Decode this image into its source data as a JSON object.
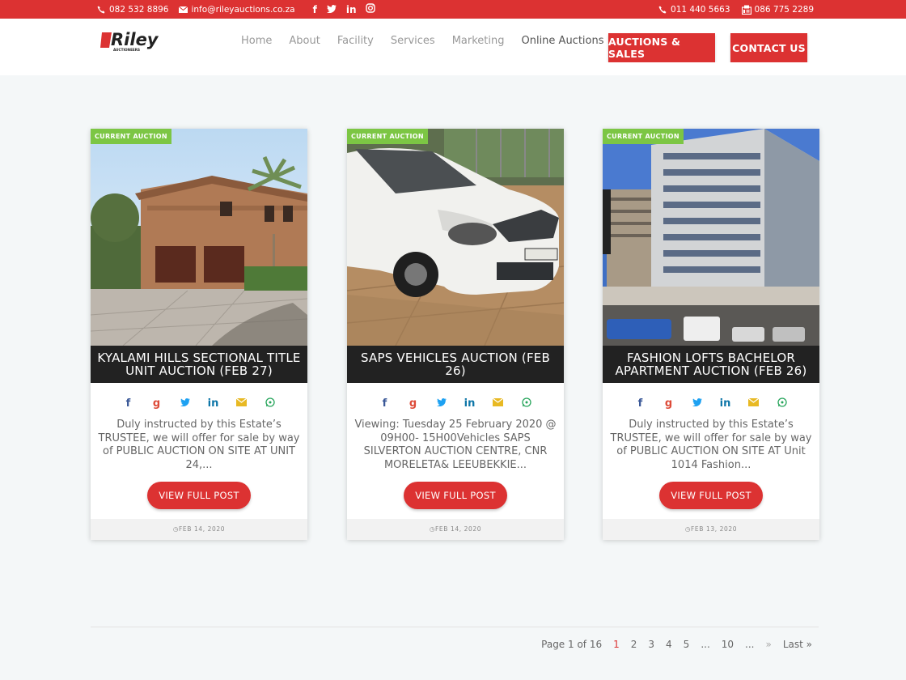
{
  "topbar": {
    "phone1": "082 532 8896",
    "email": "info@rileyauctions.co.za",
    "social": [
      "facebook-icon",
      "twitter-icon",
      "linkedin-icon",
      "instagram-icon"
    ],
    "phone2": "011 440 5663",
    "fax": "086 775 2289",
    "color": "#dc3232"
  },
  "header": {
    "logo_text": "Riley",
    "logo_sub": "AUCTIONEERS",
    "nav": [
      "Home",
      "About",
      "Facility",
      "Services",
      "Marketing",
      "Online Auctions"
    ],
    "cta1": "AUCTIONS & SALES",
    "cta2": "CONTACT US"
  },
  "cards": [
    {
      "badge": "CURRENT AUCTION",
      "title": "KYALAMI HILLS SECTIONAL TITLE UNIT AUCTION (FEB 27)",
      "excerpt": "Duly instructed by this Estate’s TRUSTEE, we will offer for sale by way of PUBLIC AUCTION ON SITE AT UNIT 24,...",
      "button": "VIEW FULL POST",
      "date": "FEB 14, 2020"
    },
    {
      "badge": "CURRENT AUCTION",
      "title": "SAPS VEHICLES AUCTION (FEB 26)",
      "excerpt": "Viewing: Tuesday 25 February 2020 @ 09H00- 15H00Vehicles SAPS SILVERTON AUCTION CENTRE, CNR MORELETA& LEEUBEKKIE...",
      "button": "VIEW FULL POST",
      "date": "FEB 14, 2020"
    },
    {
      "badge": "CURRENT AUCTION",
      "title": "FASHION LOFTS BACHELOR APARTMENT AUCTION (FEB 26)",
      "excerpt": "Duly instructed by this Estate’s TRUSTEE, we will offer for sale by way of PUBLIC AUCTION ON SITE AT Unit 1014 Fashion...",
      "button": "VIEW FULL POST",
      "date": "FEB 13, 2020"
    }
  ],
  "share_icons": [
    "facebook-icon",
    "google-plus-icon",
    "twitter-icon",
    "linkedin-icon",
    "email-icon",
    "whatsapp-icon"
  ],
  "pagination": {
    "label": "Page 1 of 16",
    "pages": [
      "1",
      "2",
      "3",
      "4",
      "5"
    ],
    "ellipsis": "...",
    "page10": "10",
    "next": "»",
    "last": "Last »"
  }
}
